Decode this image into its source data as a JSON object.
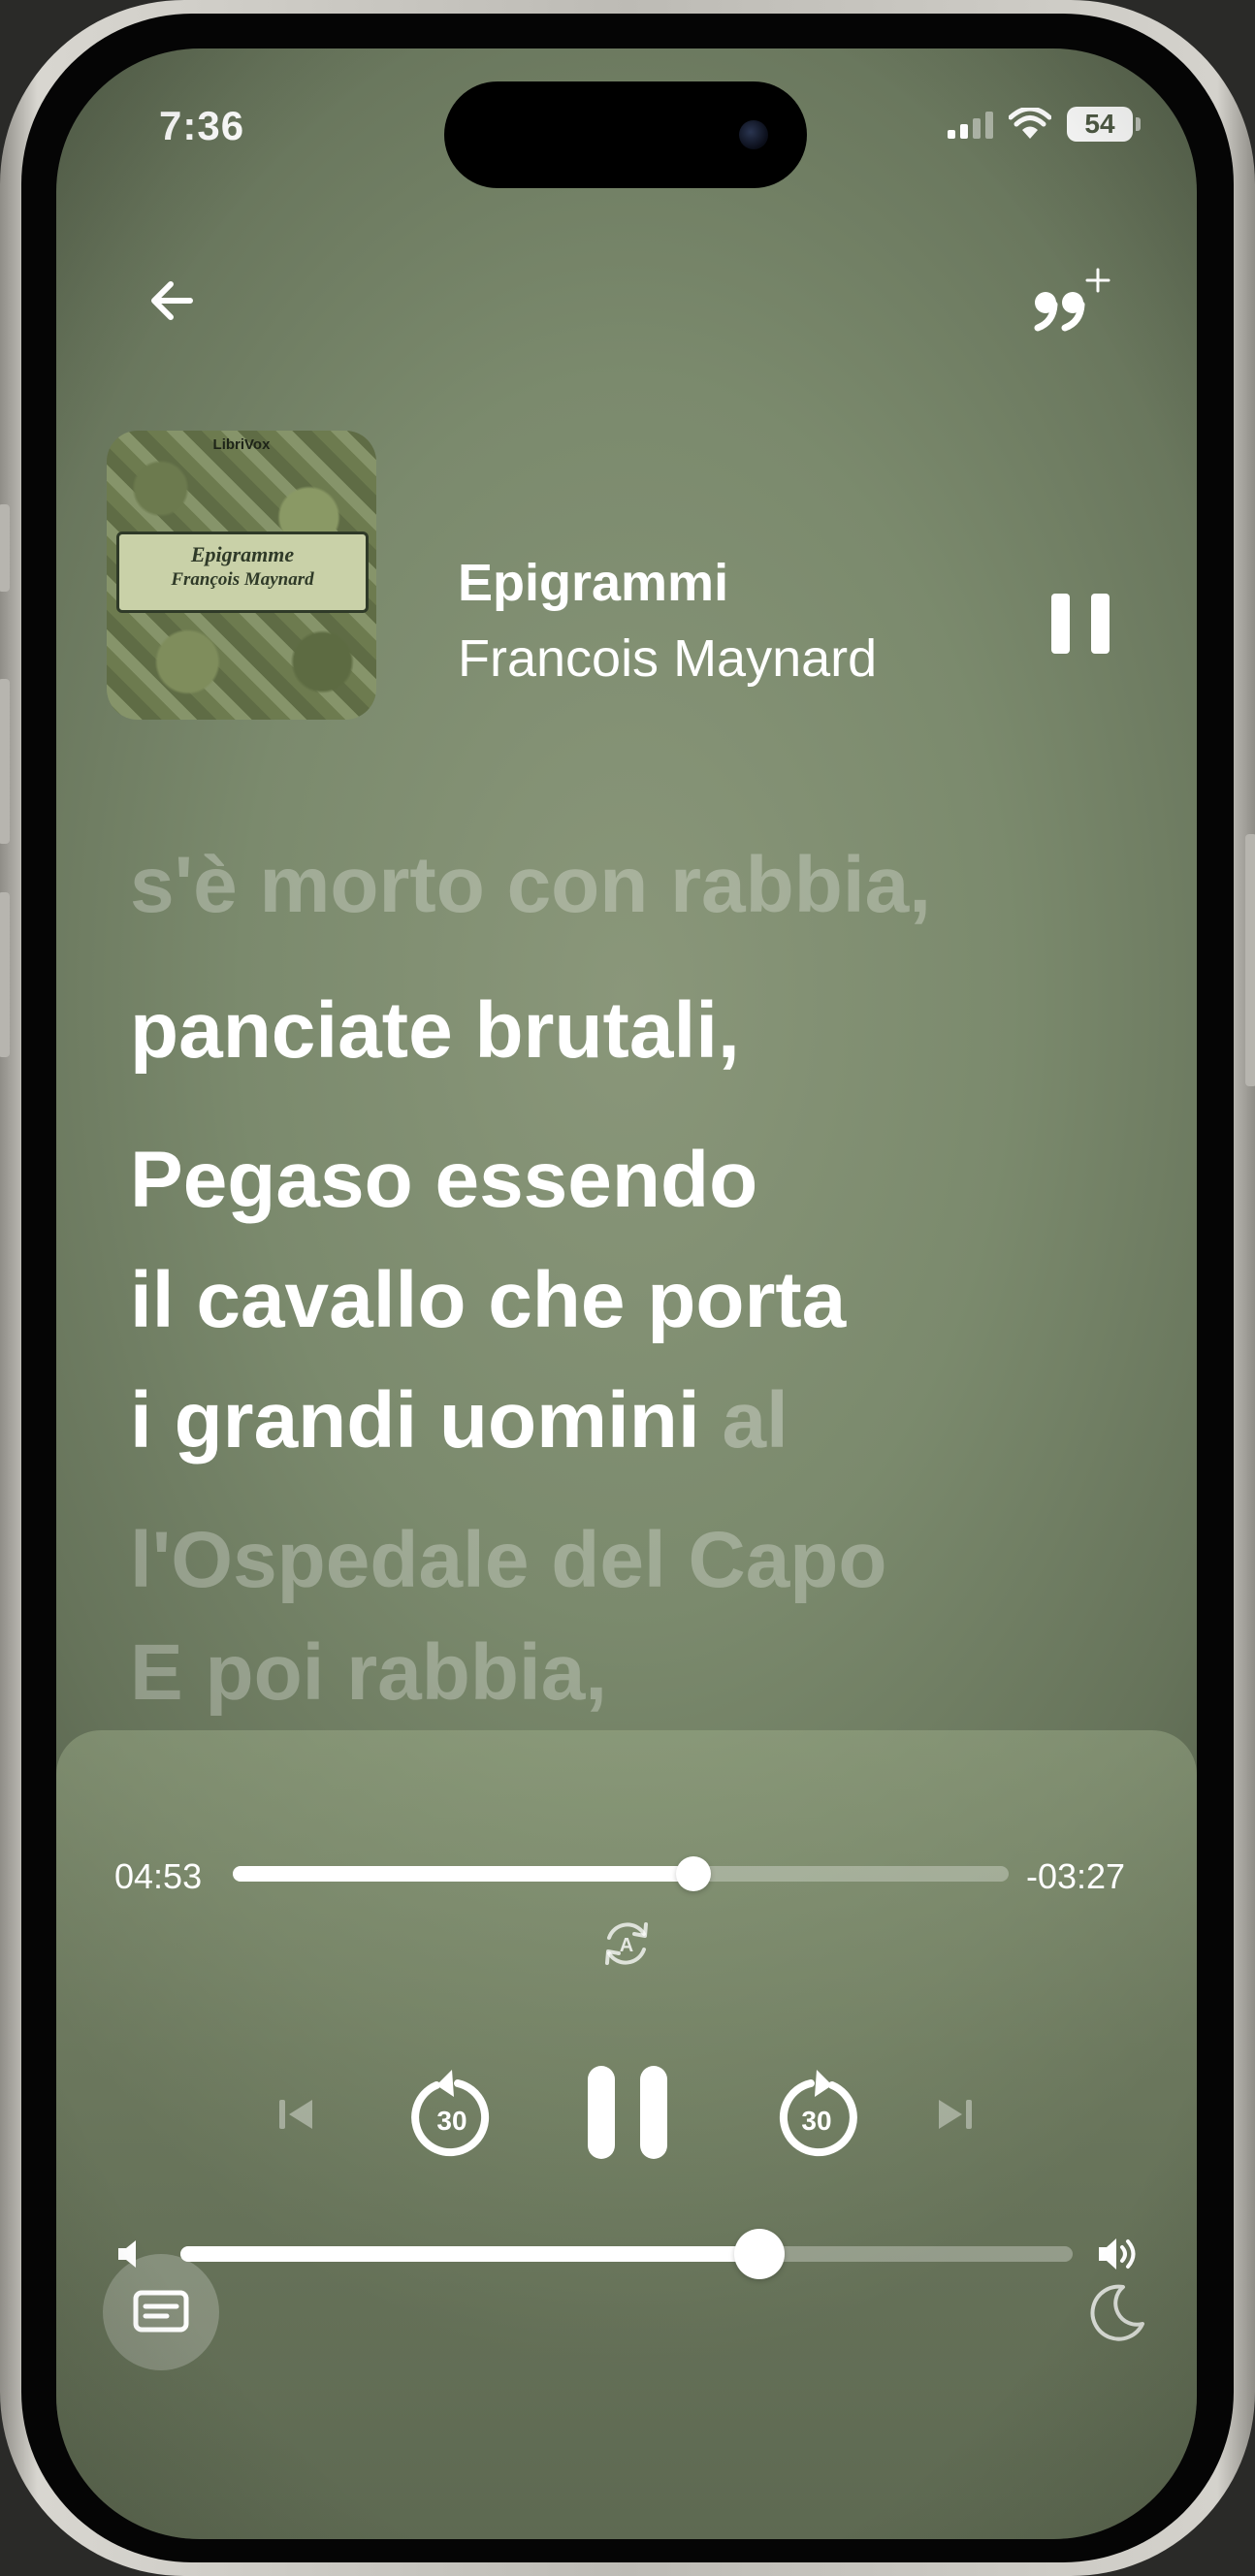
{
  "status_bar": {
    "time": "7:36",
    "battery": "54"
  },
  "nav": {
    "back_icon": "arrow-left-icon",
    "quote_icon": "quote-add-icon"
  },
  "now_playing": {
    "artwork": {
      "publisher": "LibriVox",
      "title": "Epigramme",
      "author": "François Maynard"
    },
    "title": "Epigrammi",
    "artist": "Francois Maynard",
    "state": "playing"
  },
  "lyrics": {
    "previous": "s'è morto con rabbia,",
    "line1": "panciate brutali,",
    "line2": "Pegaso essendo",
    "line3": "il cavallo che porta",
    "line4_spoken": "i grandi uomini",
    "line4_pending": " al",
    "next1": "l'Ospedale del Capo",
    "next2": "E poi rabbia,"
  },
  "player": {
    "elapsed": "04:53",
    "remaining": "-03:27",
    "progress_fraction": 0.594,
    "skip_back_seconds": "30",
    "skip_forward_seconds": "30",
    "autoplay_badge": "A",
    "volume_fraction": 0.649
  }
}
